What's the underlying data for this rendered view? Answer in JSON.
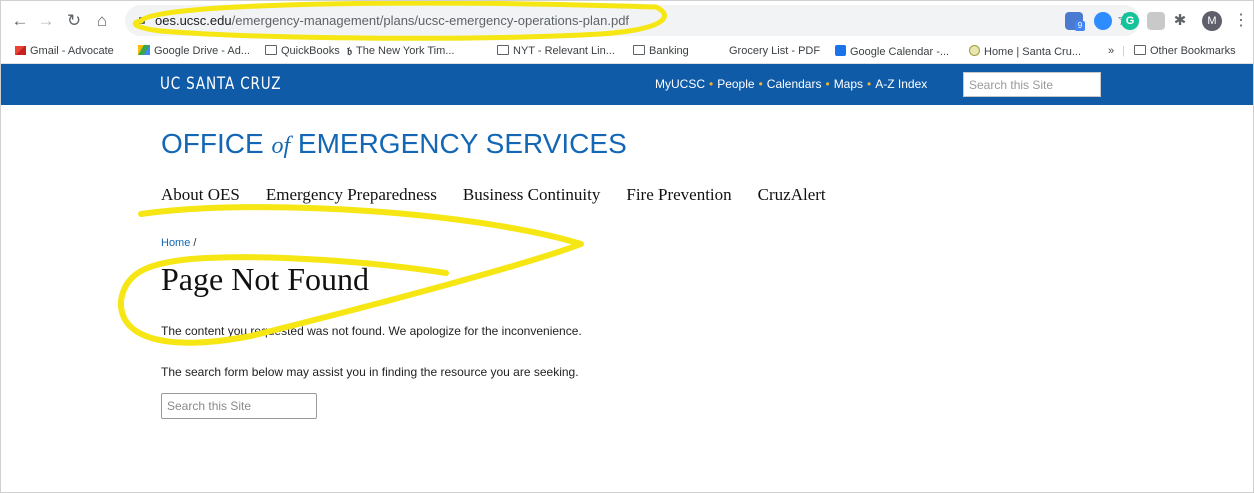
{
  "browser": {
    "url_domain": "oes.ucsc.edu",
    "url_path": "/emergency-management/plans/ucsc-emergency-operations-plan.pdf",
    "ext_badge": "9",
    "ext_grammarly": "G",
    "avatar_initial": "M",
    "bookmarks": [
      {
        "label": "Gmail - Advocate"
      },
      {
        "label": "Google Drive - Ad..."
      },
      {
        "label": "QuickBooks"
      },
      {
        "label": "The New York Tim..."
      },
      {
        "label": "NYT - Relevant Lin..."
      },
      {
        "label": "Banking"
      },
      {
        "label": "Grocery List - PDF"
      },
      {
        "label": "Google Calendar -..."
      },
      {
        "label": "Home | Santa Cru..."
      },
      {
        "label": "Other Bookmarks"
      }
    ],
    "overflow": "»"
  },
  "site": {
    "logo": "UC SANTA CRUZ",
    "top_links": [
      "MyUCSC",
      "People",
      "Calendars",
      "Maps",
      "A-Z Index"
    ],
    "search_placeholder": "Search this Site",
    "title_pre": "OFFICE ",
    "title_of": "of",
    "title_post": " EMERGENCY SERVICES",
    "nav": [
      "About OES",
      "Emergency Preparedness",
      "Business Continuity",
      "Fire Prevention",
      "CruzAlert"
    ]
  },
  "content": {
    "breadcrumb_home": "Home",
    "breadcrumb_sep": " /",
    "heading": "Page Not Found",
    "message": "The content you requested was not found. We apologize for the inconvenience.",
    "hint": "The search form below may assist you in finding the resource you are seeking.",
    "search_placeholder": "Search this Site"
  },
  "colors": {
    "site_bar": "#0f5ba8",
    "link": "#1367b5",
    "annotation": "#f5e614"
  }
}
